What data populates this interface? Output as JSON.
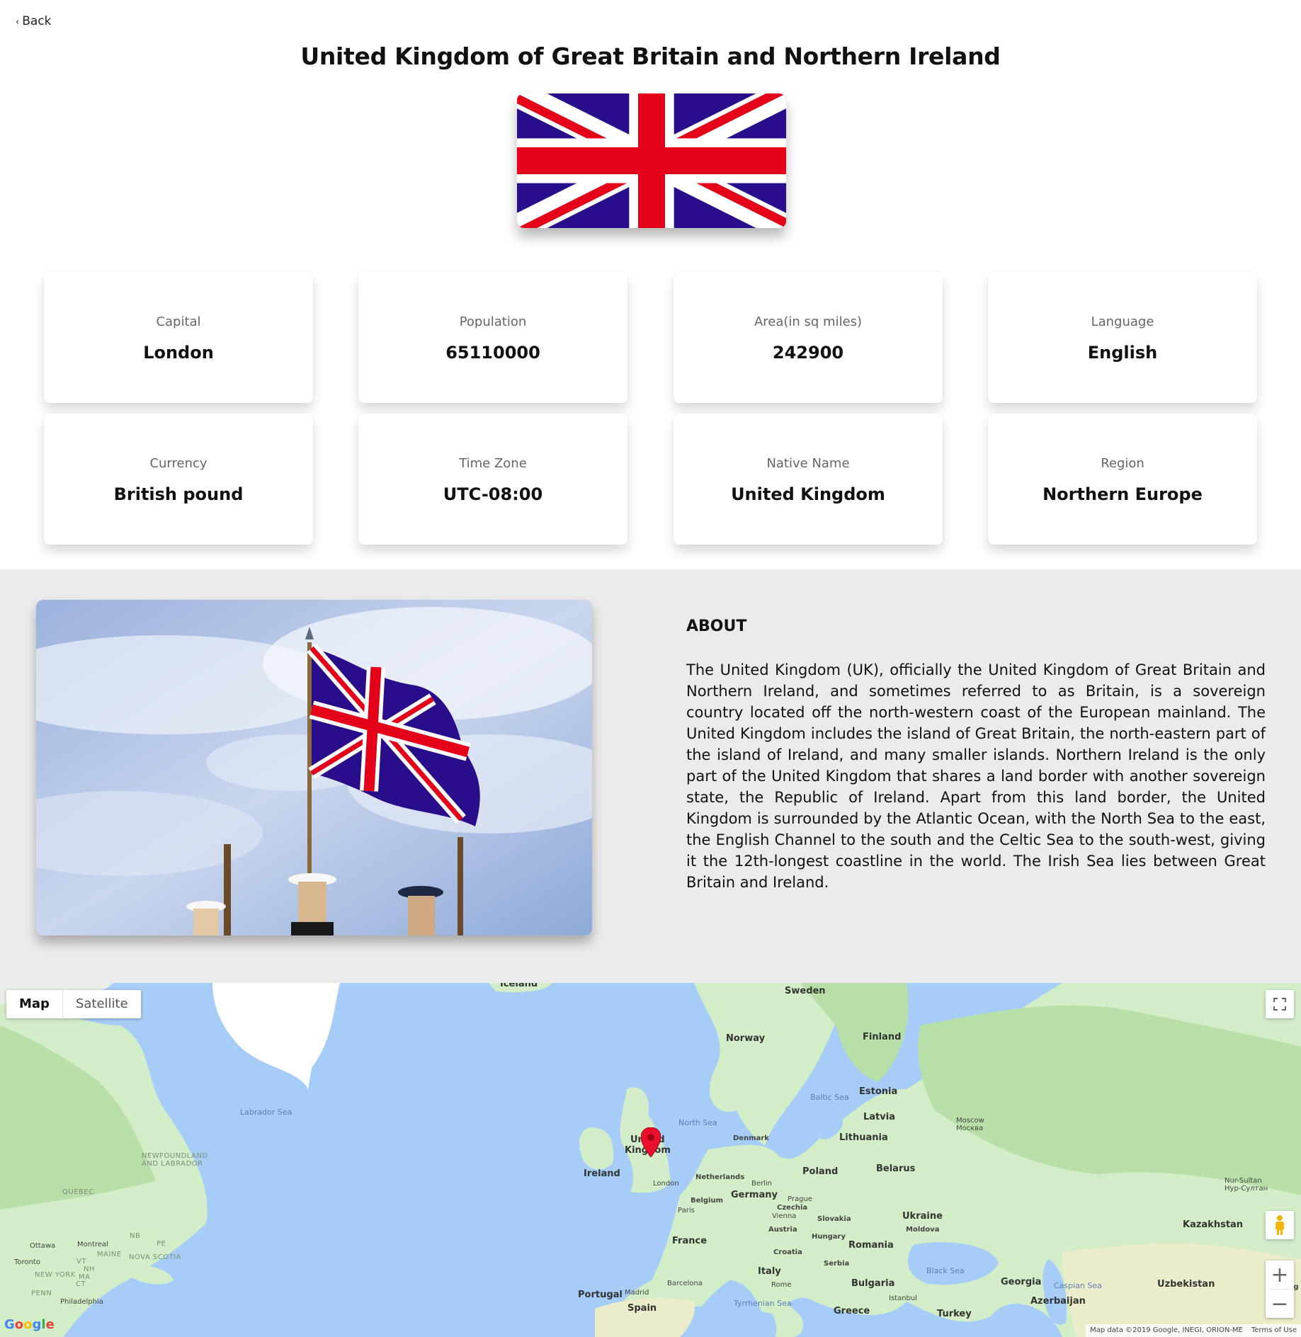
{
  "nav": {
    "back_label": "Back"
  },
  "country": {
    "name": "United Kingdom of Great Britain and Northern Ireland",
    "flag_colors": {
      "blue": "#2a0d8a",
      "red": "#e40018",
      "white": "#ffffff"
    }
  },
  "stats": [
    {
      "label": "Capital",
      "value": "London"
    },
    {
      "label": "Population",
      "value": "65110000"
    },
    {
      "label": "Area(in sq miles)",
      "value": "242900"
    },
    {
      "label": "Language",
      "value": "English"
    },
    {
      "label": "Currency",
      "value": "British pound"
    },
    {
      "label": "Time Zone",
      "value": "UTC-08:00"
    },
    {
      "label": "Native Name",
      "value": "United Kingdom"
    },
    {
      "label": "Region",
      "value": "Northern Europe"
    }
  ],
  "about": {
    "heading": "ABOUT",
    "text": "The United Kingdom (UK), officially the United Kingdom of Great Britain and Northern Ireland, and sometimes referred to as Britain, is a sovereign country located off the north-western coast of the European mainland. The United Kingdom includes the island of Great Britain, the north-eastern part of the island of Ireland, and many smaller islands. Northern Ireland is the only part of the United Kingdom that shares a land border with another sovereign state, the Republic of Ireland. Apart from this land border, the United Kingdom is surrounded by the Atlantic Ocean, with the North Sea to the east, the English Channel to the south and the Celtic Sea to the south-west, giving it the 12th-longest coastline in the world. The Irish Sea lies between Great Britain and Ireland."
  },
  "map": {
    "type_controls": {
      "map": "Map",
      "satellite": "Satellite"
    },
    "zoom_in": "+",
    "zoom_out": "−",
    "labels": {
      "iceland": "Iceland",
      "sweden": "Sweden",
      "norway": "Norway",
      "finland": "Finland",
      "labrador_sea": "Labrador Sea",
      "baltic_sea": "Baltic Sea",
      "estonia": "Estonia",
      "latvia": "Latvia",
      "north_sea": "North Sea",
      "moscow": "Moscow\nМосква",
      "denmark": "Denmark",
      "lithuania": "Lithuania",
      "uk_line1": "United",
      "uk_line2": "Kingdom",
      "newfoundland": "NEWFOUNDLAND\nAND LABRADOR",
      "ireland": "Ireland",
      "poland": "Poland",
      "belarus": "Belarus",
      "netherlands": "Netherlands",
      "berlin": "Berlin",
      "london": "London",
      "germany": "Germany",
      "quebec": "QUEBEC",
      "belgium": "Belgium",
      "prague": "Prague",
      "czechia": "Czechia",
      "nur_sultan": "Nur-Sultan\nНур-Султан",
      "paris": "Paris",
      "vienna": "Vienna",
      "slovakia": "Slovakia",
      "ukraine": "Ukraine",
      "kazakhstan": "Kazakhstan",
      "austria": "Austria",
      "moldova": "Moldova",
      "hungary": "Hungary",
      "nb": "NB",
      "pe": "PE",
      "ottawa": "Ottawa",
      "montreal": "Montreal",
      "france": "France",
      "romania": "Romania",
      "maine": "MAINE",
      "nova_scotia": "NOVA SCOTIA",
      "croatia": "Croatia",
      "toronto": "Toronto",
      "vt": "VT",
      "serbia": "Serbia",
      "black_sea": "Black Sea",
      "new_york": "NEW YORK",
      "nh": "NH",
      "italy": "Italy",
      "ma": "MA",
      "ct": "CT",
      "barcelona": "Barcelona",
      "rome": "Rome",
      "bulgaria": "Bulgaria",
      "georgia": "Georgia",
      "caspian_sea": "Caspian Sea",
      "uzbekistan": "Uzbekistan",
      "portugal": "Portugal",
      "madrid": "Madrid",
      "penn": "PENN",
      "philadelphia": "Philadelphia",
      "tyrrhenian_sea": "Tyrrhenian Sea",
      "istanbul": "Istanbul",
      "azerbaijan": "Azerbaijan",
      "kyrg": "Kyrg",
      "spain": "Spain",
      "greece": "Greece",
      "turkey": "Turkey"
    },
    "google": "Google",
    "attribution": "Map data ©2019 Google, INEGI, ORION-ME",
    "terms": "Terms of Use",
    "colors": {
      "water": "#a6cdf7",
      "land": "#d3edc8",
      "forest": "#b9dfa9",
      "pin": "#e8102a"
    }
  }
}
